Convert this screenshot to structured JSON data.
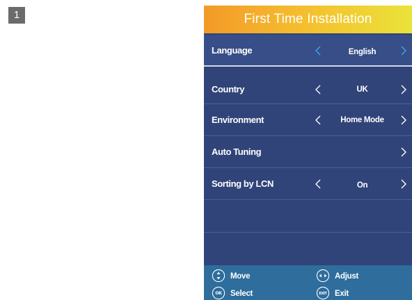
{
  "page_number": "1",
  "menu": {
    "title": "First Time Installation",
    "rows": [
      {
        "label": "Language",
        "value": "English",
        "has_left": true,
        "has_right": true,
        "selected": true
      },
      {
        "label": "Country",
        "value": "UK",
        "has_left": true,
        "has_right": true,
        "selected": false
      },
      {
        "label": "Environment",
        "value": "Home Mode",
        "has_left": true,
        "has_right": true,
        "selected": false
      },
      {
        "label": "Auto Tuning",
        "value": "",
        "has_left": false,
        "has_right": true,
        "selected": false
      },
      {
        "label": "Sorting by LCN",
        "value": "On",
        "has_left": true,
        "has_right": true,
        "selected": false
      }
    ]
  },
  "footer": {
    "move_label": "Move",
    "adjust_label": "Adjust",
    "select_label": "Select",
    "exit_label": "Exit",
    "ok_button_text": "OK",
    "exit_button_text": "EXIT"
  },
  "colors": {
    "menu_bg": "#304479",
    "header_gradient_start": "#f39a29",
    "header_gradient_end": "#e9e33a",
    "footer_bg": "#2e6d9c",
    "selected_chevron": "#3aa9e8",
    "chevron": "#ffffff"
  },
  "icons": {
    "nav_left": "chevron-left-icon",
    "nav_right": "chevron-right-icon",
    "move": "up-down-button-icon",
    "adjust": "left-right-button-icon",
    "select": "ok-button-icon",
    "exit": "exit-button-icon"
  }
}
